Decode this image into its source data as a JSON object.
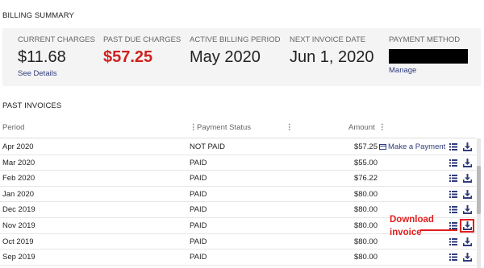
{
  "billing_summary": {
    "title": "BILLING SUMMARY",
    "current_charges": {
      "label": "CURRENT CHARGES",
      "value": "$11.68",
      "link": "See Details"
    },
    "past_due": {
      "label": "PAST DUE CHARGES",
      "value": "$57.25"
    },
    "active_period": {
      "label": "ACTIVE BILLING PERIOD",
      "value": "May 2020"
    },
    "next_invoice": {
      "label": "NEXT INVOICE DATE",
      "value": "Jun 1, 2020"
    },
    "payment_method": {
      "label": "PAYMENT METHOD",
      "link": "Manage"
    }
  },
  "past_invoices": {
    "title": "PAST INVOICES",
    "columns": {
      "period": "Period",
      "status": "Payment Status",
      "amount": "Amount"
    },
    "make_payment_label": "Make a Payment",
    "rows": [
      {
        "period": "Apr 2020",
        "status": "NOT PAID",
        "amount": "$57.25"
      },
      {
        "period": "Mar 2020",
        "status": "PAID",
        "amount": "$55.00"
      },
      {
        "period": "Feb 2020",
        "status": "PAID",
        "amount": "$76.22"
      },
      {
        "period": "Jan 2020",
        "status": "PAID",
        "amount": "$80.00"
      },
      {
        "period": "Dec 2019",
        "status": "PAID",
        "amount": "$80.00"
      },
      {
        "period": "Nov 2019",
        "status": "PAID",
        "amount": "$80.00"
      },
      {
        "period": "Oct 2019",
        "status": "PAID",
        "amount": "$80.00"
      },
      {
        "period": "Sep 2019",
        "status": "PAID",
        "amount": "$80.00"
      }
    ]
  },
  "annotation": {
    "line1": "Download",
    "line2": "invoice"
  },
  "colors": {
    "accent": "#2f3b7a",
    "past_due": "#d0201f",
    "annotation": "#e0201f"
  },
  "icons": {
    "row_details": "list-icon",
    "row_download": "download-icon",
    "make_payment": "credit-card-icon"
  }
}
